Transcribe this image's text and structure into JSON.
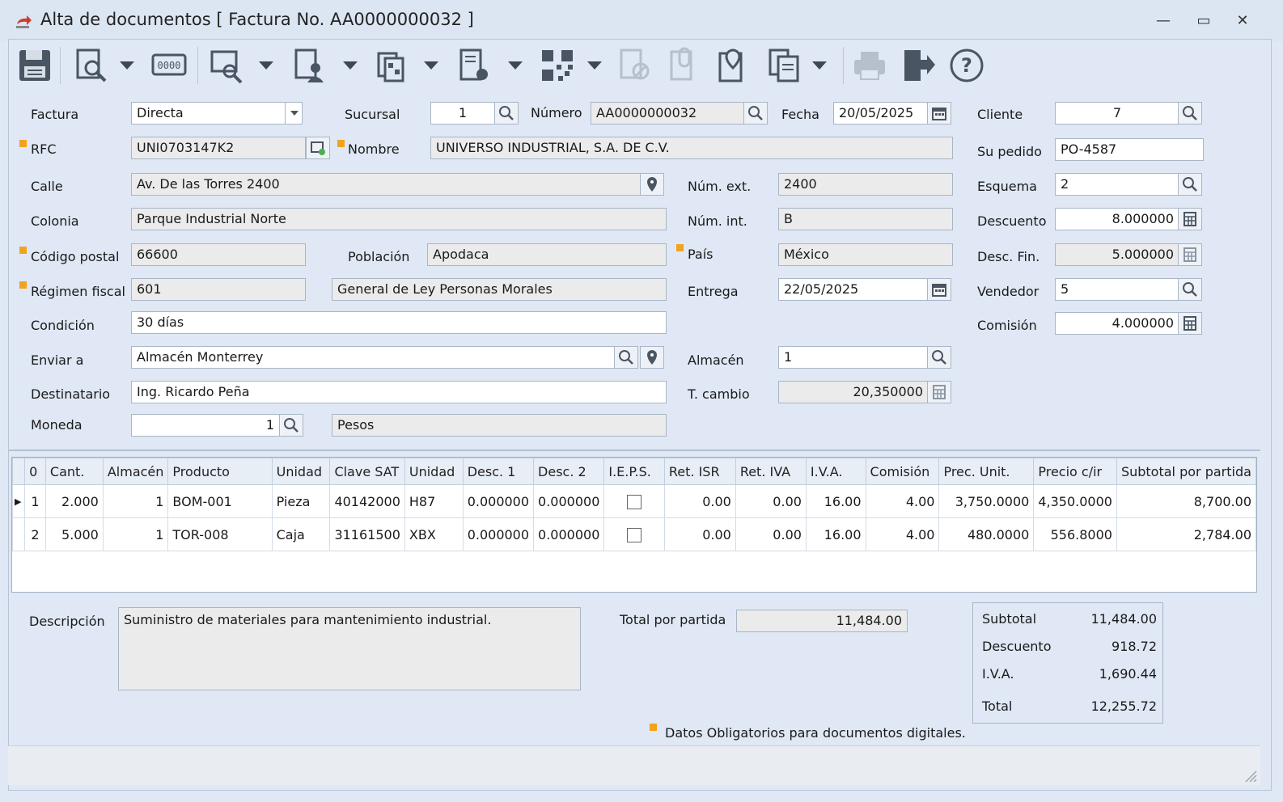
{
  "window": {
    "title": "Alta de documentos [ Factura No. AA0000000032 ]",
    "minimize": "—",
    "restore": "▭",
    "close": "✕"
  },
  "toolbar": {
    "icons": [
      "save-icon",
      "preview-icon",
      "counter-icon",
      "search-doc-icon",
      "user-doc-icon",
      "stack-icon",
      "doc-settings-icon",
      "qr-icon",
      "cancel-doc-icon",
      "attach-doc-icon",
      "location-doc-icon",
      "copy-doc-icon",
      "print-icon",
      "exit-icon",
      "help-icon"
    ]
  },
  "form": {
    "factura": {
      "label": "Factura",
      "value": "Directa"
    },
    "sucursal": {
      "label": "Sucursal",
      "value": "1"
    },
    "numero": {
      "label": "Número",
      "value": "AA0000000032"
    },
    "fecha": {
      "label": "Fecha",
      "value": "20/05/2025"
    },
    "cliente": {
      "label": "Cliente",
      "value": "7"
    },
    "rfc": {
      "label": "RFC",
      "value": "UNI0703147K2"
    },
    "nombre": {
      "label": "Nombre",
      "value": "UNIVERSO INDUSTRIAL, S.A. DE C.V."
    },
    "su_pedido": {
      "label": "Su pedido",
      "value": "PO-4587"
    },
    "calle": {
      "label": "Calle",
      "value": "Av. De las Torres 2400"
    },
    "num_ext": {
      "label": "Núm. ext.",
      "value": "2400"
    },
    "esquema": {
      "label": "Esquema",
      "value": "2"
    },
    "colonia": {
      "label": "Colonia",
      "value": "Parque Industrial Norte"
    },
    "num_int": {
      "label": "Núm. int.",
      "value": "B"
    },
    "descuento": {
      "label": "Descuento",
      "value": "8.000000"
    },
    "codigo_postal": {
      "label": "Código postal",
      "value": "66600"
    },
    "poblacion": {
      "label": "Población",
      "value": "Apodaca"
    },
    "pais": {
      "label": "País",
      "value": "México"
    },
    "desc_fin": {
      "label": "Desc. Fin.",
      "value": "5.000000"
    },
    "regimen_fiscal": {
      "label": "Régimen fiscal",
      "value": "601",
      "description": "General de Ley Personas Morales"
    },
    "entrega": {
      "label": "Entrega",
      "value": "22/05/2025"
    },
    "vendedor": {
      "label": "Vendedor",
      "value": "5"
    },
    "condicion": {
      "label": "Condición",
      "value": "30 días"
    },
    "comision": {
      "label": "Comisión",
      "value": "4.000000"
    },
    "enviar_a": {
      "label": "Enviar a",
      "value": "Almacén Monterrey"
    },
    "almacen": {
      "label": "Almacén",
      "value": "1"
    },
    "destinatario": {
      "label": "Destinatario",
      "value": "Ing. Ricardo Peña"
    },
    "t_cambio": {
      "label": "T. cambio",
      "value": "20,350000"
    },
    "moneda": {
      "label": "Moneda",
      "value": "1",
      "description": "Pesos"
    }
  },
  "grid": {
    "columns": [
      "0",
      "Cant.",
      "Almacén",
      "Producto",
      "Unidad",
      "Clave SAT",
      "Unidad",
      "Desc. 1",
      "Desc. 2",
      "I.E.P.S.",
      "Ret. ISR",
      "Ret. IVA",
      "I.V.A.",
      "Comisión",
      "Prec. Unit.",
      "Precio c/ir",
      "Subtotal por partida"
    ],
    "rows": [
      [
        "1",
        "2.000",
        "1",
        "BOM-001",
        "Pieza",
        "40142000",
        "H87",
        "0.000000",
        "0.000000",
        "",
        "0.00",
        "0.00",
        "16.00",
        "4.00",
        "3,750.0000",
        "4,350.0000",
        "8,700.00"
      ],
      [
        "2",
        "5.000",
        "1",
        "TOR-008",
        "Caja",
        "31161500",
        "XBX",
        "0.000000",
        "0.000000",
        "",
        "0.00",
        "0.00",
        "16.00",
        "4.00",
        "480.0000",
        "556.8000",
        "2,784.00"
      ]
    ],
    "selected_row_marker": "▶"
  },
  "footer": {
    "descripcion_label": "Descripción",
    "descripcion_value": "Suministro de materiales para mantenimiento industrial.",
    "total_partida_label": "Total por partida",
    "total_partida_value": "11,484.00",
    "subtotal_label": "Subtotal",
    "subtotal_value": "11,484.00",
    "descuento_label": "Descuento",
    "descuento_value": "918.72",
    "iva_label": "I.V.A.",
    "iva_value": "1,690.44",
    "total_label": "Total",
    "total_value": "12,255.72",
    "legend": "Datos Obligatorios para documentos digitales."
  },
  "colors": {
    "required_marker": "#f2a31e",
    "background": "#dfe8f4"
  }
}
